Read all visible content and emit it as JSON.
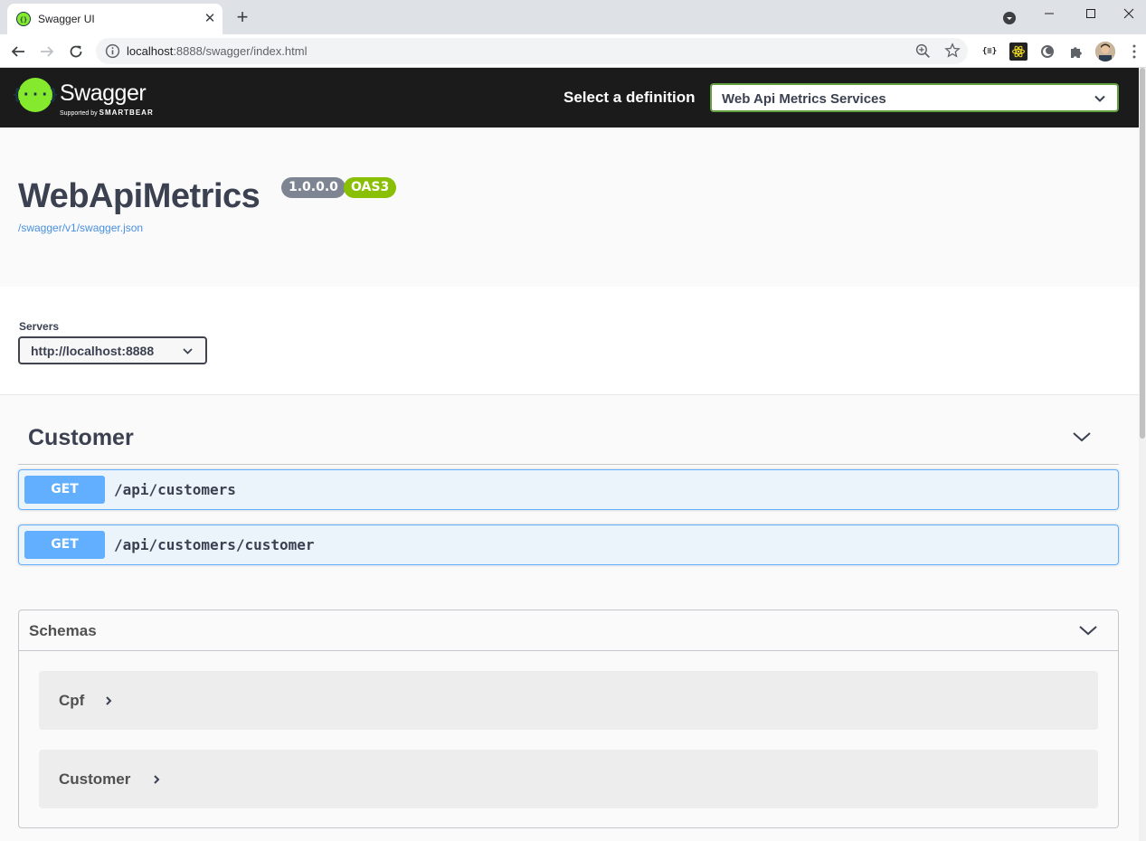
{
  "browser": {
    "tab_title": "Swagger UI",
    "tab_close": "✕",
    "new_tab": "+",
    "url_host": "localhost",
    "url_path": ":8888/swagger/index.html",
    "ext_json_label": "{≡}"
  },
  "topbar": {
    "logo_glyph": "{···}",
    "logo_name": "Swagger",
    "logo_supported": "Supported by",
    "logo_brand": "SMARTBEAR",
    "definition_label": "Select a definition",
    "definition_selected": "Web Api Metrics Services"
  },
  "info": {
    "title": "WebApiMetrics",
    "version": "1.0.0.0",
    "oas": "OAS3",
    "spec_link": "/swagger/v1/swagger.json"
  },
  "servers": {
    "label": "Servers",
    "selected": "http://localhost:8888"
  },
  "tag": {
    "name": "Customer",
    "operations": [
      {
        "method": "GET",
        "path": "/api/customers"
      },
      {
        "method": "GET",
        "path": "/api/customers/customer"
      }
    ]
  },
  "schemas": {
    "title": "Schemas",
    "models": [
      "Cpf",
      "Customer"
    ]
  },
  "colors": {
    "get": "#61affe",
    "get_bg": "#ebf3fb",
    "topbar": "#1b1b1b",
    "swagger_green": "#85ea2d",
    "oas_badge": "#89bf04",
    "version_badge": "#7d8492",
    "link": "#4990e2"
  }
}
